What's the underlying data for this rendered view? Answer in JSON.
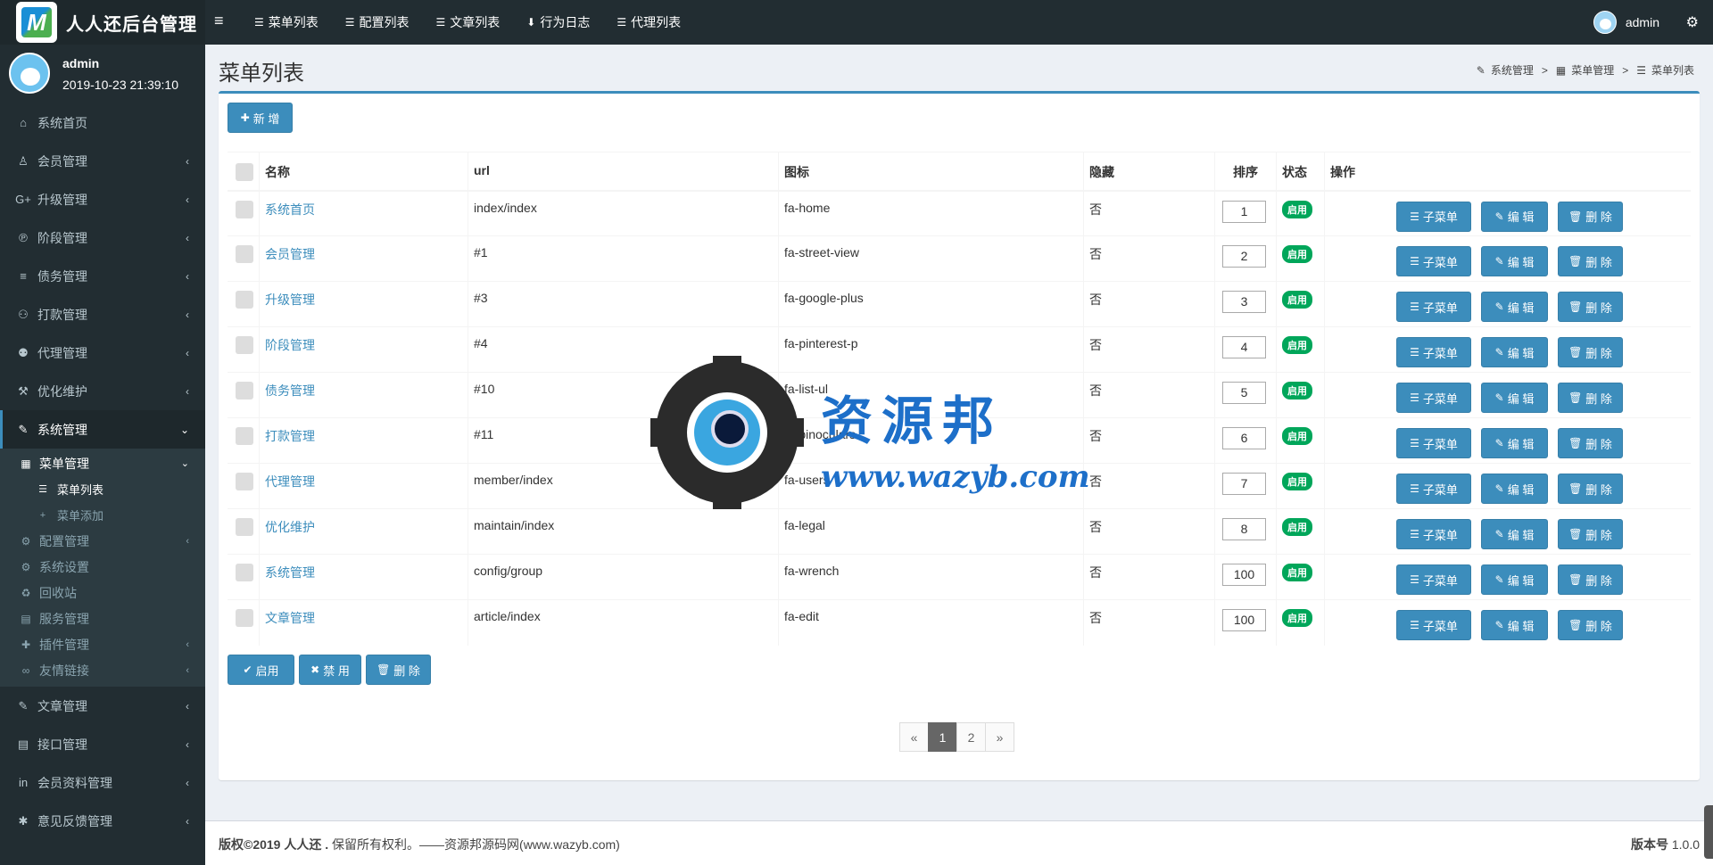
{
  "app": {
    "logo_letter": "M",
    "title": "人人还后台管理"
  },
  "topnav": [
    {
      "icon": "☰",
      "label": "菜单列表"
    },
    {
      "icon": "☰",
      "label": "配置列表"
    },
    {
      "icon": "☰",
      "label": "文章列表"
    },
    {
      "icon": "⬇",
      "label": "行为日志"
    },
    {
      "icon": "☰",
      "label": "代理列表"
    }
  ],
  "user": {
    "name": "admin",
    "time": "2019-10-23 21:39:10"
  },
  "sidebar": {
    "items_top": [
      {
        "icon": "⌂",
        "label": "系统首页",
        "chev": ""
      },
      {
        "icon": "♙",
        "label": "会员管理",
        "chev": "‹"
      },
      {
        "icon": "G+",
        "label": "升级管理",
        "chev": "‹"
      },
      {
        "icon": "℗",
        "label": "阶段管理",
        "chev": "‹"
      },
      {
        "icon": "≡",
        "label": "债务管理",
        "chev": "‹"
      },
      {
        "icon": "⚇",
        "label": "打款管理",
        "chev": "‹"
      },
      {
        "icon": "⚉",
        "label": "代理管理",
        "chev": "‹"
      },
      {
        "icon": "⚒",
        "label": "优化维护",
        "chev": "‹"
      }
    ],
    "active": {
      "icon": "✎",
      "label": "系统管理",
      "chev": "⌄"
    },
    "sub_open": {
      "icon": "▦",
      "label": "菜单管理",
      "chev": "⌄"
    },
    "sub_sub": [
      {
        "icon": "☰",
        "label": "菜单列表"
      },
      {
        "icon": "+",
        "label": "菜单添加"
      }
    ],
    "sub_items": [
      {
        "icon": "⚙",
        "label": "配置管理",
        "chev": "‹"
      },
      {
        "icon": "⚙",
        "label": "系统设置",
        "chev": ""
      },
      {
        "icon": "♻",
        "label": "回收站",
        "chev": ""
      },
      {
        "icon": "▤",
        "label": "服务管理",
        "chev": ""
      },
      {
        "icon": "✚",
        "label": "插件管理",
        "chev": "‹"
      },
      {
        "icon": "∞",
        "label": "友情链接",
        "chev": "‹"
      }
    ],
    "items_bottom": [
      {
        "icon": "✎",
        "label": "文章管理",
        "chev": "‹"
      },
      {
        "icon": "▤",
        "label": "接口管理",
        "chev": "‹"
      },
      {
        "icon": "in",
        "label": "会员资料管理",
        "chev": "‹"
      },
      {
        "icon": "✱",
        "label": "意见反馈管理",
        "chev": "‹"
      }
    ]
  },
  "page": {
    "title": "菜单列表",
    "breadcrumb": [
      {
        "icon": "✎",
        "label": "系统管理"
      },
      {
        "icon": "▦",
        "label": "菜单管理"
      },
      {
        "icon": "☰",
        "label": "菜单列表"
      }
    ],
    "add_label": "新 增"
  },
  "table": {
    "headers": {
      "name": "名称",
      "url": "url",
      "icon": "图标",
      "hidden": "隐藏",
      "sort": "排序",
      "status": "状态",
      "ops": "操作"
    },
    "rows": [
      {
        "name": "系统首页",
        "url": "index/index",
        "icon": "fa-home",
        "hidden": "否",
        "sort": "1",
        "status": "启用"
      },
      {
        "name": "会员管理",
        "url": "#1",
        "icon": "fa-street-view",
        "hidden": "否",
        "sort": "2",
        "status": "启用"
      },
      {
        "name": "升级管理",
        "url": "#3",
        "icon": "fa-google-plus",
        "hidden": "否",
        "sort": "3",
        "status": "启用"
      },
      {
        "name": "阶段管理",
        "url": "#4",
        "icon": "fa-pinterest-p",
        "hidden": "否",
        "sort": "4",
        "status": "启用"
      },
      {
        "name": "债务管理",
        "url": "#10",
        "icon": "fa-list-ul",
        "hidden": "否",
        "sort": "5",
        "status": "启用"
      },
      {
        "name": "打款管理",
        "url": "#11",
        "icon": "fa-binoculars",
        "hidden": "否",
        "sort": "6",
        "status": "启用"
      },
      {
        "name": "代理管理",
        "url": "member/index",
        "icon": "fa-users",
        "hidden": "否",
        "sort": "7",
        "status": "启用"
      },
      {
        "name": "优化维护",
        "url": "maintain/index",
        "icon": "fa-legal",
        "hidden": "否",
        "sort": "8",
        "status": "启用"
      },
      {
        "name": "系统管理",
        "url": "config/group",
        "icon": "fa-wrench",
        "hidden": "否",
        "sort": "100",
        "status": "启用"
      },
      {
        "name": "文章管理",
        "url": "article/index",
        "icon": "fa-edit",
        "hidden": "否",
        "sort": "100",
        "status": "启用"
      }
    ],
    "op_labels": {
      "sub": "子菜单",
      "edit": "编 辑",
      "delete": "删 除"
    }
  },
  "bulk": {
    "enable": "启用",
    "disable": "禁 用",
    "delete": "删 除"
  },
  "pager": [
    "«",
    "1",
    "2",
    "»"
  ],
  "pager_active": "1",
  "footer": {
    "copyright": "版权©2019 人人还 .",
    "rights": " 保留所有权利。——资源邦源码网(www.wazyb.com)",
    "version_label": "版本号",
    "version": " 1.0.0"
  },
  "watermark": {
    "cn": "资源邦",
    "url": "www.wazyb.com"
  }
}
